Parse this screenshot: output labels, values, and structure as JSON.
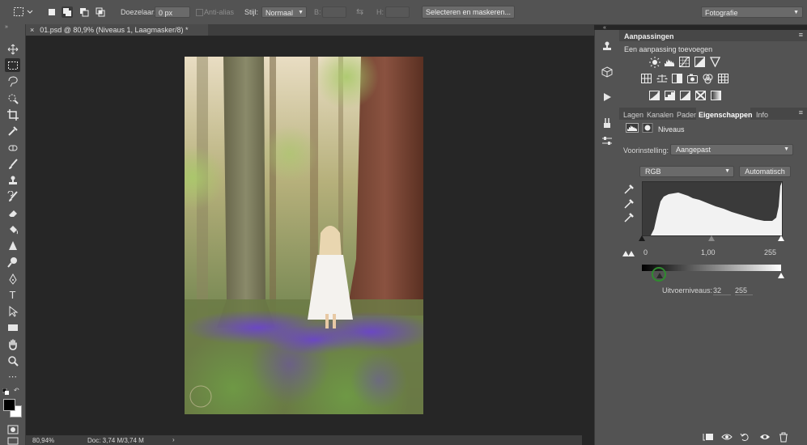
{
  "options_bar": {
    "feather_label": "Doezelaar:",
    "feather_value": "0 px",
    "antialias_label": "Anti-alias",
    "style_label": "Stijl:",
    "style_value": "Normaal",
    "width_label": "B:",
    "height_label": "H:",
    "select_mask_label": "Selecteren en maskeren...",
    "workspace_value": "Fotografie"
  },
  "document": {
    "tab_title": "01.psd @ 80,9% (Niveaus 1, Laagmasker/8) *",
    "zoom": "80,94%",
    "doc_size": "Doc: 3,74 M/3,74 M"
  },
  "adjustments": {
    "title": "Aanpassingen",
    "add_label": "Een aanpassing toevoegen"
  },
  "tabs": [
    "Lagen",
    "Kanalen",
    "Paden",
    "Eigenschappen",
    "Info"
  ],
  "active_tab": "Eigenschappen",
  "properties": {
    "title": "Niveaus",
    "preset_label": "Voorinstelling:",
    "preset_value": "Aangepast",
    "channel_value": "RGB",
    "auto_label": "Automatisch",
    "input_black": "0",
    "input_gamma": "1,00",
    "input_white": "255",
    "output_label": "Uitvoerniveaus:",
    "output_black": "32",
    "output_white": "255"
  },
  "colors": {
    "ui_dark": "#262626",
    "panel": "#535353",
    "accent_green": "#2f8b2f"
  }
}
